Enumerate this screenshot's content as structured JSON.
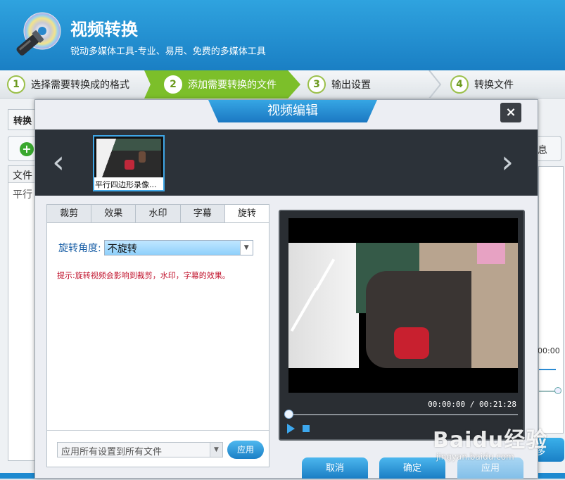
{
  "app": {
    "title": "视频转换",
    "subtitle": "锐动多媒体工具-专业、易用、免费的多媒体工具"
  },
  "steps": [
    {
      "num": "1",
      "label": "选择需要转换成的格式"
    },
    {
      "num": "2",
      "label": "添加需要转换的文件"
    },
    {
      "num": "3",
      "label": "输出设置"
    },
    {
      "num": "4",
      "label": "转换文件"
    }
  ],
  "background": {
    "tab_label": "转换",
    "list_header": "文件",
    "list_row": "平行",
    "right_button": "息",
    "right_time": "00:00",
    "bottom_button": "多"
  },
  "dialog": {
    "title": "视频编辑",
    "close": "×",
    "prev_arrow": "‹",
    "next_arrow": "›",
    "thumb_caption": "平行四边形录像...",
    "tabs": [
      "裁剪",
      "效果",
      "水印",
      "字幕",
      "旋转"
    ],
    "active_tab": "旋转",
    "rotate_label": "旋转角度:",
    "rotate_value": "不旋转",
    "hint": "提示:旋转视频会影响到裁剪，水印，字幕的效果。",
    "apply_all_value": "应用所有设置到所有文件",
    "apply_small": "应用",
    "time_current": "00:00:00",
    "time_sep": "/",
    "time_total": "00:21:28",
    "btn_cancel": "取消",
    "btn_ok": "确定",
    "btn_apply": "应用"
  },
  "watermark": {
    "brand": "Baidu经验",
    "url": "jingyan.baidu.com"
  },
  "colors": {
    "header_blue": "#1a7fc4",
    "step_active_green": "#7cbf2a",
    "button_blue": "#1b7fc6",
    "hint_red": "#c0102a"
  }
}
